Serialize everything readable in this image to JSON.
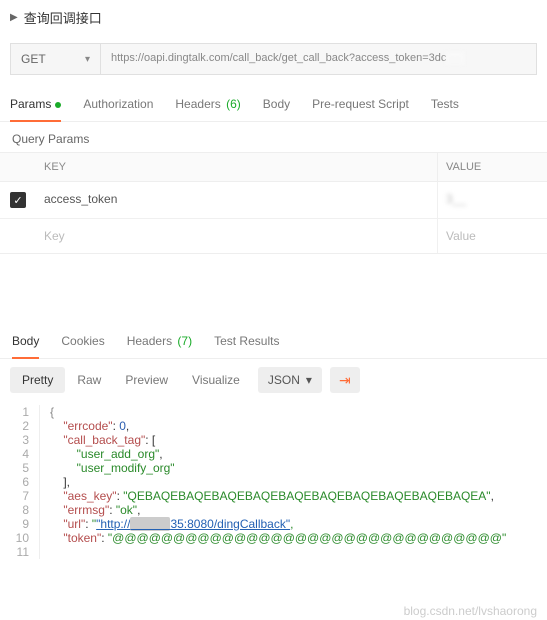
{
  "header": {
    "title": "查询回调接口"
  },
  "request": {
    "method": "GET",
    "url": "https://oapi.dingtalk.com/call_back/get_call_back?access_token=3dc",
    "tabs": {
      "params": "Params",
      "auth": "Authorization",
      "headers": "Headers",
      "headers_count": "(6)",
      "body": "Body",
      "prerequest": "Pre-request Script",
      "tests": "Tests"
    },
    "query_params": {
      "title": "Query Params",
      "columns": {
        "key": "KEY",
        "value": "VALUE"
      },
      "rows": [
        {
          "checked": true,
          "key": "access_token",
          "value": "3__"
        }
      ],
      "placeholder": {
        "key": "Key",
        "value": "Value"
      }
    }
  },
  "response": {
    "tabs": {
      "body": "Body",
      "cookies": "Cookies",
      "headers": "Headers",
      "headers_count": "(7)",
      "results": "Test Results"
    },
    "toolbar": {
      "pretty": "Pretty",
      "raw": "Raw",
      "preview": "Preview",
      "visualize": "Visualize",
      "format": "JSON"
    },
    "body": {
      "errcode": 0,
      "call_back_tag": [
        "user_add_org",
        "user_modify_org"
      ],
      "aes_key": "QEBAQEBAQEBAQEBAQEBAQEBAQEBAQEBAQEBAQEBAQEA",
      "errmsg": "ok",
      "url": "http://___.___.___.35:8080/dingCallback",
      "token": "@@@@@@@@@@@@@@@@@@@@@@@@@@@@@@@@"
    },
    "labels": {
      "errcode": "\"errcode\"",
      "call_back_tag": "\"call_back_tag\"",
      "aes_key": "\"aes_key\"",
      "errmsg": "\"errmsg\"",
      "url": "\"url\"",
      "token": "\"token\""
    },
    "values_fmt": {
      "cbt0": "\"user_add_org\"",
      "cbt1": "\"user_modify_org\"",
      "aes_key": "\"QEBAQEBAQEBAQEBAQEBAQEBAQEBAQEBAQEBAQEBAQEA\"",
      "errmsg": "\"ok\"",
      "url_pre": "\"http://",
      "url_mid": "   .   .   .",
      "url_suf": "35:8080/dingCallback\"",
      "token": "\"@@@@@@@@@@@@@@@@@@@@@@@@@@@@@@@@\""
    }
  },
  "watermark": "blog.csdn.net/lvshaorong"
}
